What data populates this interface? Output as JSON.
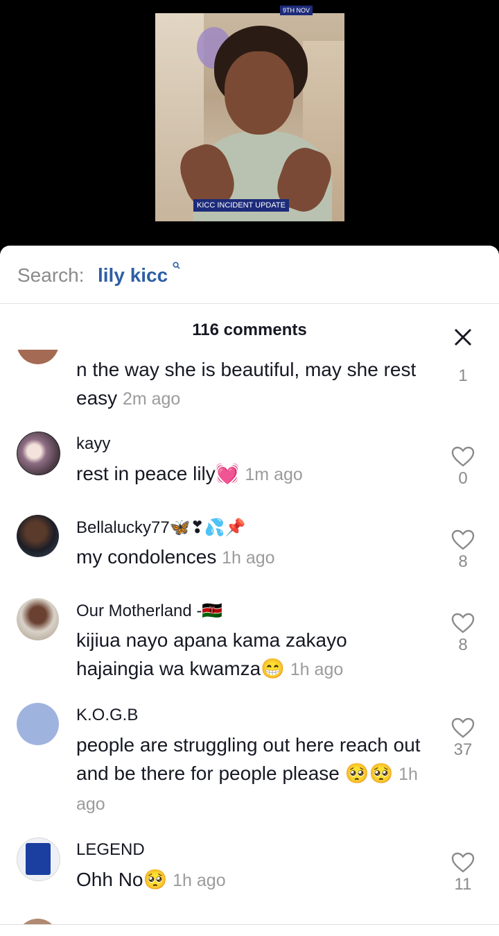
{
  "video": {
    "date_tag": "9TH NOV",
    "title_tag": "KICC INCIDENT UPDATE"
  },
  "search": {
    "prefix": "Search:",
    "term": "lily kicc",
    "icon": "search-icon"
  },
  "comments_header": {
    "count_label": "116 comments",
    "close_icon": "close-icon"
  },
  "comments": [
    {
      "username": "",
      "text": "n the way she is beautiful, may she rest easy",
      "time": "2m ago",
      "likes": "1"
    },
    {
      "username": "kayy",
      "text": "rest in peace lily💓",
      "time": "1m ago",
      "likes": "0"
    },
    {
      "username": "Bellalucky77🦋❣💦📌",
      "text": "my condolences",
      "time": "1h ago",
      "likes": "8"
    },
    {
      "username": "Our Motherland -🇰🇪",
      "text": "kijiua nayo apana kama zakayo hajaingia wa kwamza😁",
      "time": "1h ago",
      "likes": "8"
    },
    {
      "username": "K.O.G.B",
      "text": "people are struggling out here reach out and be there for people please 🥺🥺",
      "time": "1h ago",
      "likes": "37"
    },
    {
      "username": "LEGEND",
      "text": "Ohh No🥺",
      "time": "1h ago",
      "likes": "11"
    }
  ],
  "colors": {
    "search_term": "#2d5ea6",
    "tag_bg": "#1d2b7a",
    "muted": "#9b9b9b"
  }
}
